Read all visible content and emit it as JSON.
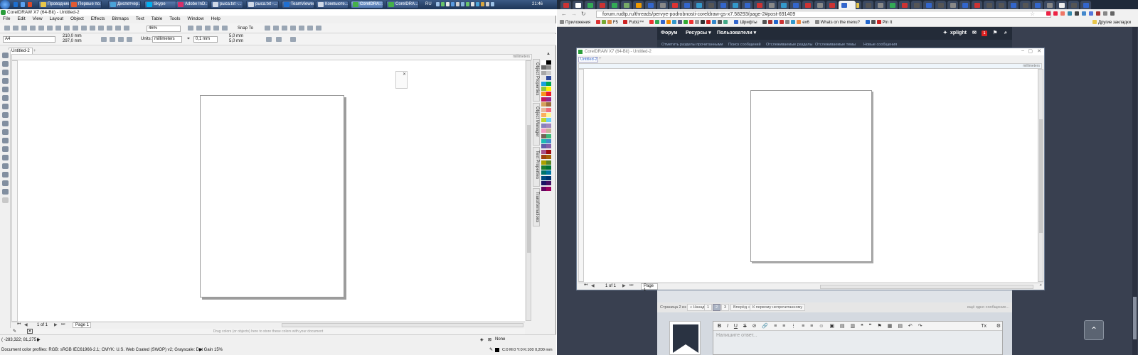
{
  "taskbar": {
    "buttons": [
      {
        "label": "Проводник",
        "icon_color": "#e8c64a"
      },
      {
        "label": "Первые по...",
        "icon_color": "#e05a33"
      },
      {
        "label": "Диспетчер...",
        "icon_color": "#4aa3d8"
      },
      {
        "label": "Skype",
        "icon_color": "#00aff0"
      },
      {
        "label": "Adobe InD...",
        "icon_color": "#d6306b"
      },
      {
        "label": "рыса.txt -...",
        "icon_color": "#cfd8e6"
      },
      {
        "label": "рыса.txt -...",
        "icon_color": "#cfd8e6"
      },
      {
        "label": "TeamViewer",
        "icon_color": "#1f6fd1"
      },
      {
        "label": "Компьюте...",
        "icon_color": "#cfd8e6"
      },
      {
        "label": "CorelDRA...",
        "icon_color": "#46b04a"
      },
      {
        "label": "CorelDRA...",
        "icon_color": "#46b04a"
      }
    ],
    "lang": "RU",
    "clock": "21:46"
  },
  "coreldraw": {
    "title": "CorelDRAW X7 (64-Bit) - Untitled-2",
    "menu": [
      "File",
      "Edit",
      "View",
      "Layout",
      "Object",
      "Effects",
      "Bitmaps",
      "Text",
      "Table",
      "Tools",
      "Window",
      "Help"
    ],
    "zoom": "46%",
    "snap_to": "Snap To",
    "page_size": "A4",
    "width": "210,0 mm",
    "height": "297,0 mm",
    "units_label": "Units:",
    "units": "millimeters",
    "nudge": "0,1 mm",
    "dup_x": "5,0 mm",
    "dup_y": "5,0 mm",
    "doc_tab": "Untitled-2",
    "ruler_unit": "millimeters",
    "dockers": [
      "Object Properties",
      "Object Manager",
      "Text Properties",
      "Transformations"
    ],
    "page_nav": "1 of 1",
    "page_tab": "Page 1",
    "drag_hint": "Drag colors (or objects) here to store these colors with your document",
    "coords": "( -283,322; 81,275 )",
    "fill_none": "None",
    "color_profiles": "Document color profiles: RGB: sRGB IEC61966-2.1; CMYK: U.S. Web Coated (SWOP) v2; Grayscale: Dot Gain 15%",
    "outline": "C:0 M:0 Y:0 K:100  0,200 mm",
    "palette": [
      "#ffffff",
      "#000000",
      "#6b6b6b",
      "#8c8c8c",
      "#a8a8a8",
      "#c9c9c9",
      "#e6e6e6",
      "#2e4a9c",
      "#1aa0e0",
      "#00a651",
      "#8dc63f",
      "#fff200",
      "#f7941d",
      "#ed1c24",
      "#c2185b",
      "#92278f",
      "#d4a15b",
      "#9e6b3b",
      "#e8b89a",
      "#f26d7d",
      "#fbaf5d",
      "#fff799",
      "#bfd730",
      "#6dcff6",
      "#8781bd",
      "#a186be",
      "#f49ac1",
      "#c7b299",
      "#736357",
      "#3cb878",
      "#1cbbb4",
      "#448ccb",
      "#605ca8",
      "#855fa8",
      "#a8518a",
      "#9e0b0f",
      "#a0410d",
      "#a3620a",
      "#aba000",
      "#598527",
      "#197b30",
      "#007236",
      "#00746b",
      "#0076a3",
      "#004a80",
      "#003471",
      "#1b1464",
      "#440e62",
      "#630460",
      "#9e005d"
    ]
  },
  "browser": {
    "url": "forum.rudtp.ru/threads/pervye-podrobnosti-coreldraw-gs-x7.58293/page-2#post-691409",
    "bookmarks": [
      "Приложения",
      "F5",
      "Fubiz™",
      "",
      "",
      "",
      "",
      "Шрифты",
      "",
      "",
      "",
      "ex6",
      "Whats on the menu?",
      "",
      "Pin It",
      "Другие закладки"
    ],
    "nav": {
      "forum": "Форум",
      "resources": "Ресурсы ▾",
      "users": "Пользователи ▾",
      "user": "xplight",
      "notif": "1"
    },
    "subnav": [
      "Отметить разделы прочитанными",
      "Поиск сообщений",
      "Отслеживаемые разделы",
      "Отслеживаемые темы",
      "Новые сообщения"
    ],
    "embedded_window": {
      "title": "CorelDRAW X7 (64-Bit) - Untitled-2",
      "tab": "Untitled-2",
      "ruler_unit": "millimeters",
      "page_nav": "1 of 1",
      "page_tab": "Page 1"
    },
    "pagination": {
      "label": "Страница 2 из 3",
      "prev": "« Назад",
      "pages": [
        "1",
        "2",
        "3"
      ],
      "next": "Вперёд »",
      "unread": "К первому непрочитанному",
      "more": "ещё одно сообщение..."
    },
    "reply_placeholder": "Напишите ответ...",
    "editor_tools": [
      "B",
      "I",
      "U",
      "S",
      "⊘",
      "🔗",
      "≡",
      "≡",
      "⋮",
      "≡",
      "≡",
      "☺",
      "▣",
      "▤",
      "▥",
      "❝",
      "❞",
      "⚑",
      "▦",
      "▤",
      "↶",
      "↷",
      "Tx",
      "⚙"
    ]
  }
}
